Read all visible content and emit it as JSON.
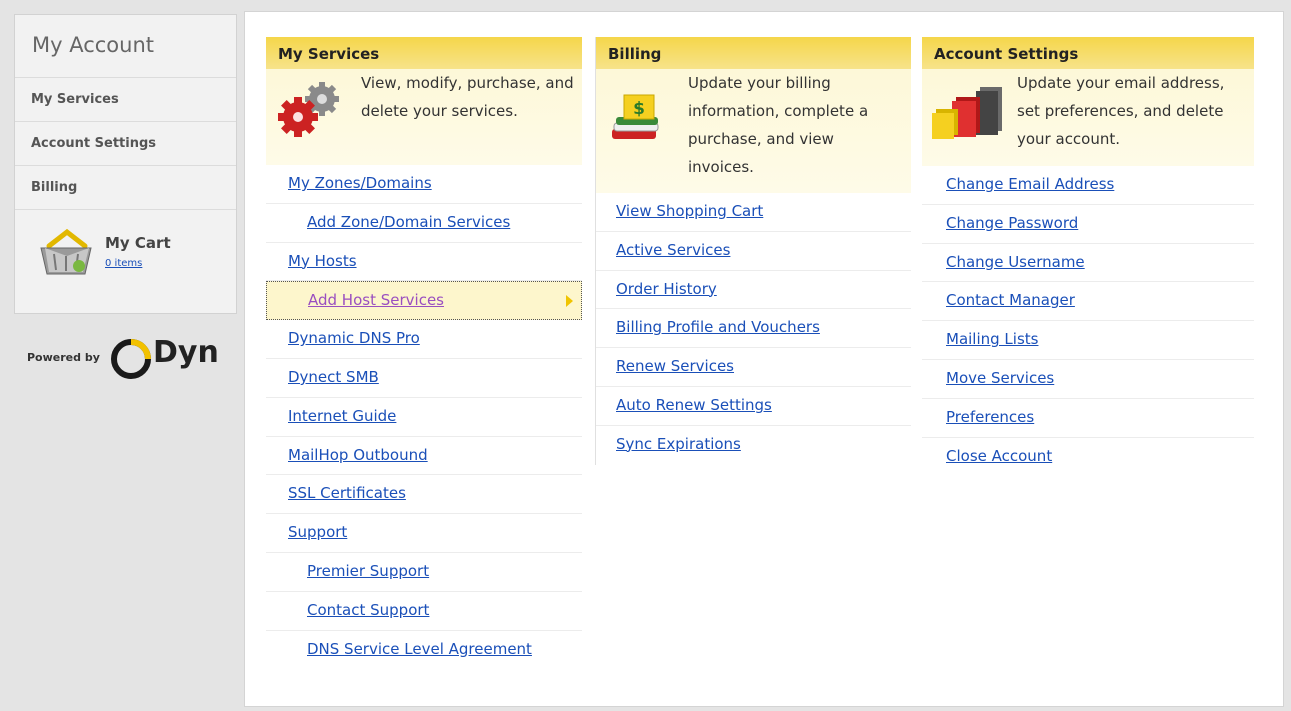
{
  "sidebar": {
    "title": "My Account",
    "items": [
      {
        "label": "My Services"
      },
      {
        "label": "Account Settings"
      },
      {
        "label": "Billing"
      }
    ],
    "cart": {
      "label": "My Cart",
      "items_text": "0 items"
    }
  },
  "powered_by": {
    "text": "Powered by",
    "brand": "Dyn"
  },
  "services": {
    "title": "My Services",
    "intro": "View, modify, purchase, and delete your services.",
    "links": [
      "My Zones/Domains",
      "Add Zone/Domain Services",
      "My Hosts",
      "Add Host Services",
      "Dynamic DNS Pro",
      "Dynect SMB",
      "Internet Guide",
      "MailHop Outbound",
      "SSL Certificates",
      "Support",
      "Premier Support",
      "Contact Support",
      "DNS Service Level Agreement"
    ]
  },
  "billing": {
    "title": "Billing",
    "intro": "Update your billing information, complete a purchase, and view invoices.",
    "links": [
      "View Shopping Cart",
      "Active Services",
      "Order History",
      "Billing Profile and Vouchers",
      "Renew Services",
      "Auto Renew Settings",
      "Sync Expirations"
    ]
  },
  "account": {
    "title": "Account Settings",
    "intro": "Update your email address, set preferences, and delete your account.",
    "links": [
      "Change Email Address",
      "Change Password",
      "Change Username",
      "Contact Manager",
      "Mailing Lists",
      "Move Services",
      "Preferences",
      "Close Account"
    ]
  },
  "icons": {
    "services": "gears-icon",
    "billing": "invoice-books-icon",
    "account": "settings-blocks-icon",
    "cart": "shopping-basket-icon",
    "logo": "dyn-logo-icon"
  },
  "colors": {
    "header_yellow": "#f5d64a",
    "link_blue": "#1a4fb8",
    "active_link_purple": "#9a4fc0"
  }
}
